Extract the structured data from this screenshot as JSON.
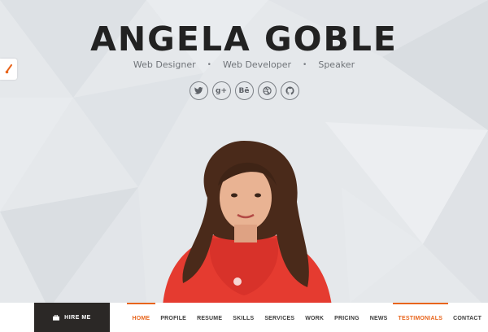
{
  "hero": {
    "name": "ANGELA GOBLE",
    "roles": [
      "Web Designer",
      "Web Developer",
      "Speaker"
    ],
    "separator": "•"
  },
  "socials": [
    {
      "icon": "twitter-icon"
    },
    {
      "icon": "google-plus-icon",
      "label": "g+"
    },
    {
      "icon": "behance-icon",
      "label": "Bē"
    },
    {
      "icon": "dribbble-icon"
    },
    {
      "icon": "github-icon"
    }
  ],
  "settings": {
    "icon": "paintbrush-icon"
  },
  "navbar": {
    "hire_label": "HIRE ME",
    "hire_icon": "briefcase-icon",
    "items": [
      "HOME",
      "PROFILE",
      "RESUME",
      "SKILLS",
      "SERVICES",
      "WORK",
      "PRICING",
      "NEWS",
      "TESTIMONIALS",
      "CONTACT"
    ],
    "highlighted": [
      "HOME",
      "TESTIMONIALS"
    ]
  },
  "colors": {
    "accent": "#e8651c",
    "dark": "#2b2826",
    "title": "#222222",
    "background": "#e4e7ea"
  }
}
